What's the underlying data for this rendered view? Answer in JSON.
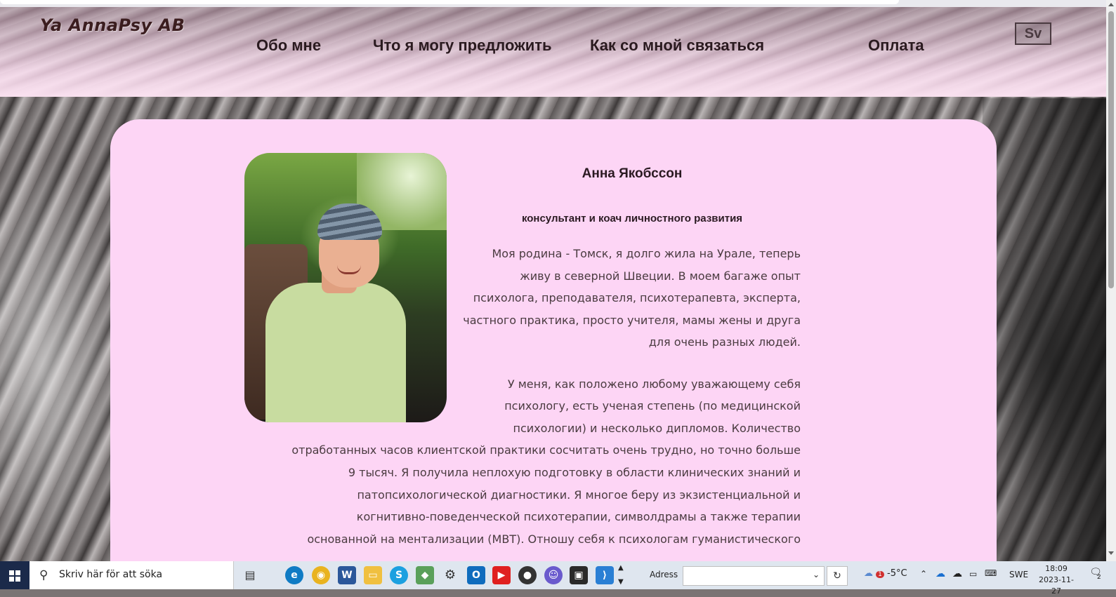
{
  "site": {
    "logo": "Ya AnnaPsy AB",
    "nav": [
      "Обо мне",
      "Что я могу предложить",
      "Как со мной связаться",
      "Оплата"
    ],
    "language_button": "Sv"
  },
  "profile": {
    "name": "Анна Якобссон",
    "subtitle": "консультант и коач личностного развития",
    "paragraph1": "Моя родина - Томск, я долго жила на Урале, теперь живу в северной Швеции. В моем багаже опыт психолога, преподавателя, психотерапевта, эксперта, частного практика, просто учителя, мамы жены и друга для очень разных людей.",
    "paragraph2_lines": [
      "У меня, как положено любому уважающему себя",
      "психологу, есть ученая степень (по медицинской",
      "психологии) и несколько дипломов. Количество",
      "отработанных часов клиентской практики сосчитать очень трудно, но точно больше",
      "9 тысяч. Я получила неплохую подготовку в области клинических знаний и",
      "патопсихологической диагностики. Я многое беру из экзистенциальной и",
      "когнитивно-поведенческой психотерапии, символдрамы а также терапии",
      "основанной на ментализации (MBT). Отношу себя к психологам гуманистического"
    ]
  },
  "taskbar": {
    "search_placeholder": "Skriv här för att söka",
    "apps": [
      "task-view",
      "edge",
      "chrome",
      "word",
      "file-explorer",
      "skype",
      "git",
      "settings",
      "outlook",
      "youtube",
      "obs",
      "discord",
      "terminal",
      "vscode"
    ],
    "address_label": "Adress",
    "weather": "-5°C",
    "weather_badge": "1",
    "language": "SWE",
    "time": "18:09",
    "date": "2023-11-27",
    "notifications": "2"
  }
}
